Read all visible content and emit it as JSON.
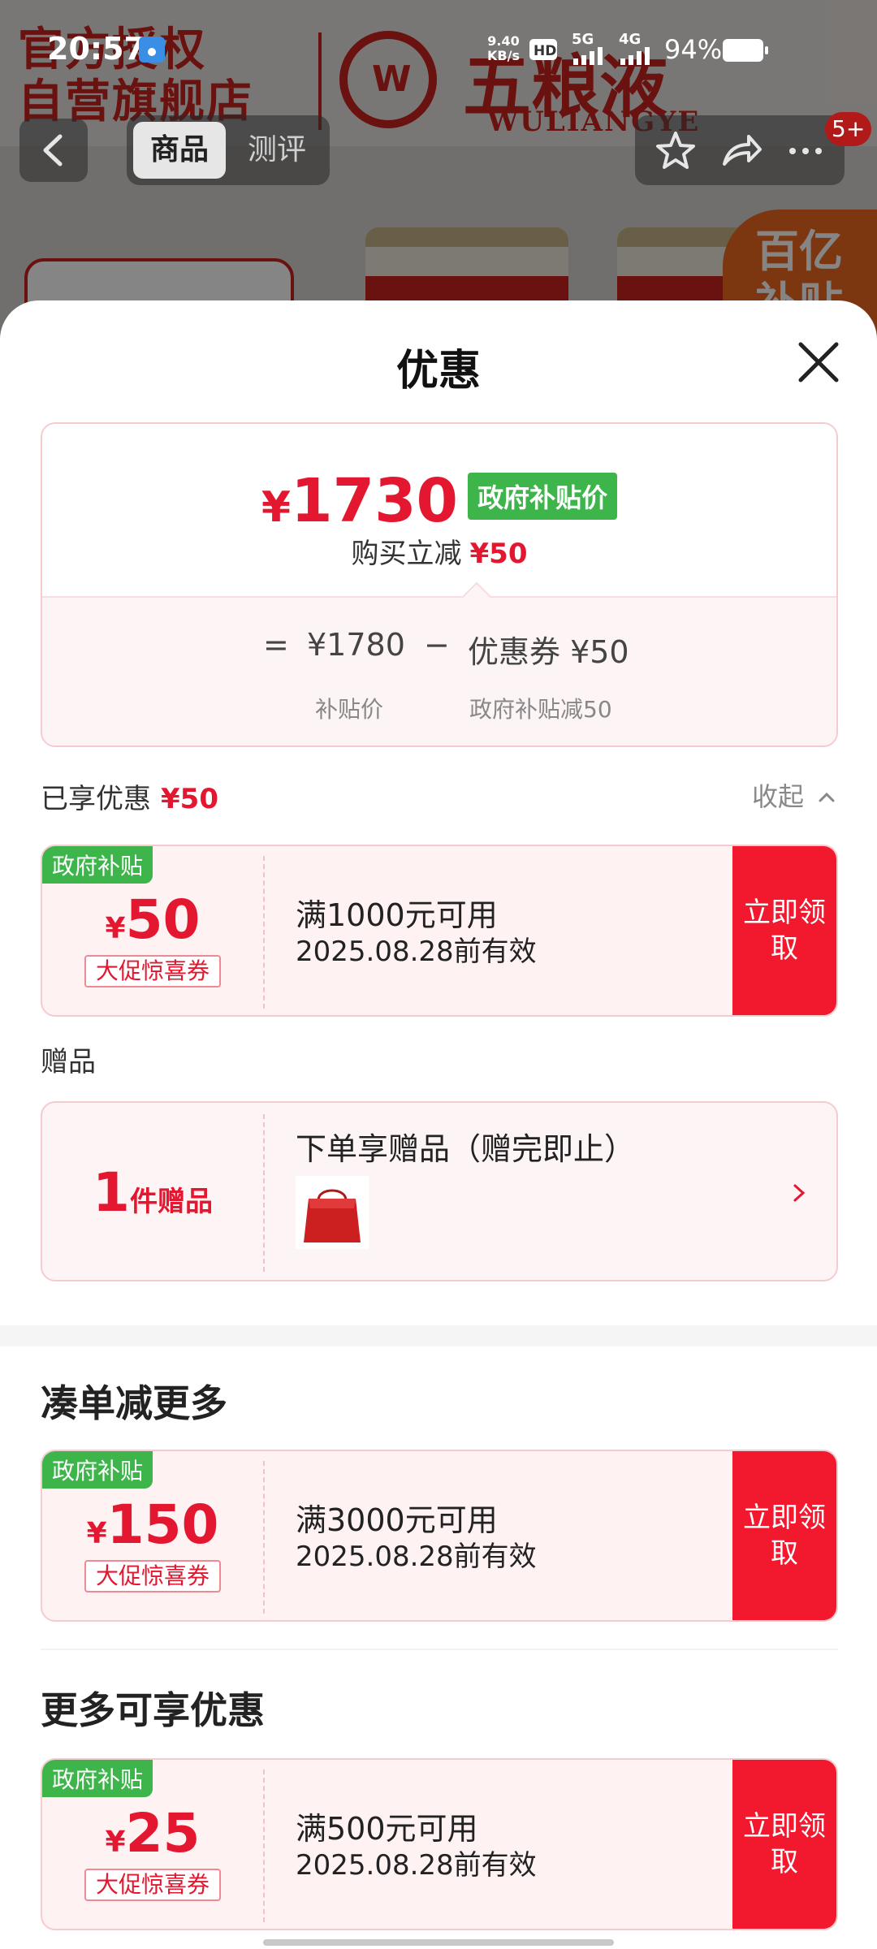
{
  "status_bar": {
    "time": "20:57",
    "net_speed": "9.40",
    "net_unit": "KB/s",
    "signal_5g": "5G",
    "signal_4g": "4G",
    "battery_pct": "94%"
  },
  "background": {
    "store_line1": "官方授权",
    "store_line2": "自营旗舰店",
    "logo_letter": "W",
    "brand_cn": "五粮液",
    "brand_en": "WULIANGYE",
    "badge_line1": "百亿",
    "badge_line2": "补贴"
  },
  "nav": {
    "back_icon": "chevron-left-icon",
    "tabs": [
      {
        "label": "商品",
        "active": true
      },
      {
        "label": "测评",
        "active": false
      }
    ],
    "cart_badge": "5+"
  },
  "sheet": {
    "title": "优惠",
    "summary": {
      "currency": "¥",
      "final_price": "1730",
      "price_tag": "政府补贴价",
      "reduce_label": "购买立减",
      "reduce_amount": "¥50",
      "equals": "=",
      "base_price": "¥1780",
      "minus": "−",
      "coupon_part": "优惠券 ¥50",
      "base_label": "补贴价",
      "coupon_label": "政府补贴减50"
    },
    "enjoyed": {
      "label": "已享优惠",
      "amount": "¥50",
      "collapse": "收起"
    },
    "coupons": [
      {
        "tag": "政府补贴",
        "currency": "¥",
        "amount": "50",
        "badge": "大促惊喜券",
        "condition": "满1000元可用",
        "valid": "2025.08.28前有效",
        "claim": "立即领取"
      },
      {
        "tag": "政府补贴",
        "currency": "¥",
        "amount": "150",
        "badge": "大促惊喜券",
        "condition": "满3000元可用",
        "valid": "2025.08.28前有效",
        "claim": "立即领取"
      },
      {
        "tag": "政府补贴",
        "currency": "¥",
        "amount": "25",
        "badge": "大促惊喜券",
        "condition": "满500元可用",
        "valid": "2025.08.28前有效",
        "claim": "立即领取"
      }
    ],
    "gift": {
      "title": "赠品",
      "count": "1",
      "count_unit": "件赠品",
      "desc": "下单享赠品（赠完即止）"
    },
    "section_more_discount": "凑单减更多",
    "section_more_offers": "更多可享优惠"
  },
  "colors": {
    "accent_red": "#e3172f",
    "claim_red": "#f2182e",
    "gov_green": "#3db54b",
    "coupon_bg": "#fff2f3"
  }
}
